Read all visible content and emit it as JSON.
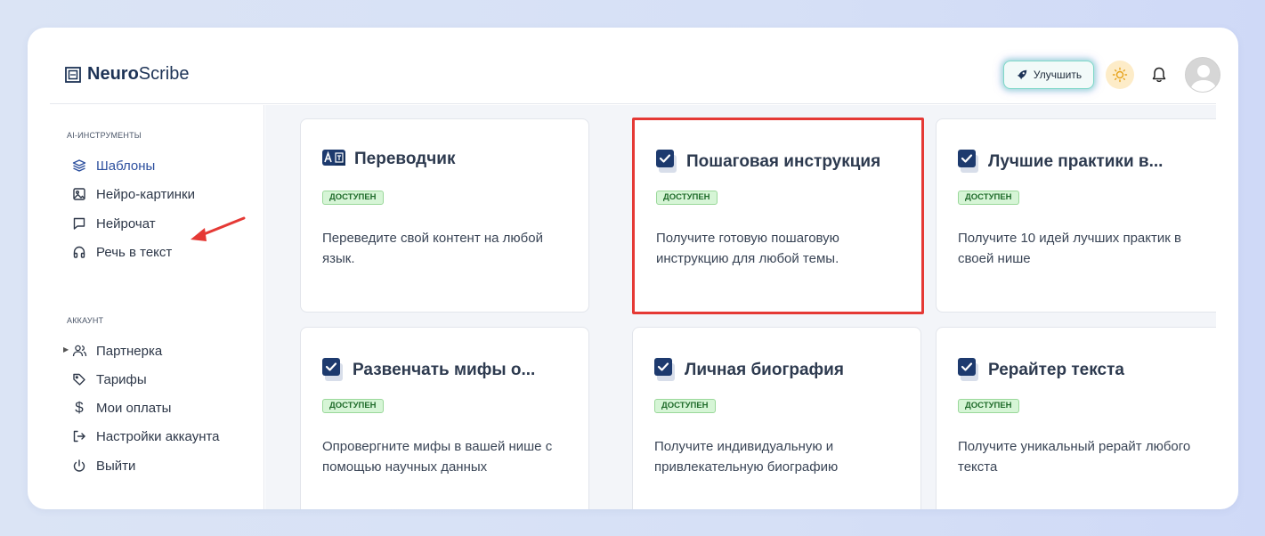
{
  "logo": {
    "bold": "Neuro",
    "regular": "Scribe"
  },
  "header": {
    "upgrade_label": "Улучшить"
  },
  "sidebar": {
    "section_tools": "AI-ИНСТРУМЕНТЫ",
    "section_account": "АККАУНТ",
    "tools": [
      {
        "label": "Шаблоны",
        "icon": "layers-icon",
        "active": true
      },
      {
        "label": "Нейро-картинки",
        "icon": "image-icon"
      },
      {
        "label": "Нейрочат",
        "icon": "chat-icon"
      },
      {
        "label": "Речь в текст",
        "icon": "headphones-icon"
      }
    ],
    "account": [
      {
        "label": "Партнерка",
        "icon": "users-icon"
      },
      {
        "label": "Тарифы",
        "icon": "tag-icon"
      },
      {
        "label": "Мои оплаты",
        "icon": "dollar-icon"
      },
      {
        "label": "Настройки аккаунта",
        "icon": "logout-icon"
      },
      {
        "label": "Выйти",
        "icon": "power-icon"
      }
    ]
  },
  "cards": [
    {
      "title": "Переводчик",
      "badge": "ДОСТУПЕН",
      "desc": "Переведите свой контент на любой язык.",
      "icon": "translate-icon"
    },
    {
      "title": "Пошаговая инструкция",
      "badge": "ДОСТУПЕН",
      "desc": "Получите готовую пошаговую инструкцию для любой темы.",
      "icon": "checkbox-icon",
      "highlighted": true
    },
    {
      "title": "Лучшие практики в...",
      "badge": "ДОСТУПЕН",
      "desc": "Получите 10 идей лучших практик в своей нише",
      "icon": "checkbox-icon"
    },
    {
      "title": "Развенчать мифы о...",
      "badge": "ДОСТУПЕН",
      "desc": "Опровергните мифы в вашей нише с помощью научных данных",
      "icon": "checkbox-icon"
    },
    {
      "title": "Личная биография",
      "badge": "ДОСТУПЕН",
      "desc": "Получите индивидуальную и привлекательную биографию",
      "icon": "checkbox-icon"
    },
    {
      "title": "Рерайтер текста",
      "badge": "ДОСТУПЕН",
      "desc": "Получите уникальный рерайт любого текста",
      "icon": "checkbox-icon"
    }
  ],
  "colors": {
    "accent": "#2c4f9e",
    "highlight": "#e53935",
    "badge_bg": "#d6f5d6"
  }
}
